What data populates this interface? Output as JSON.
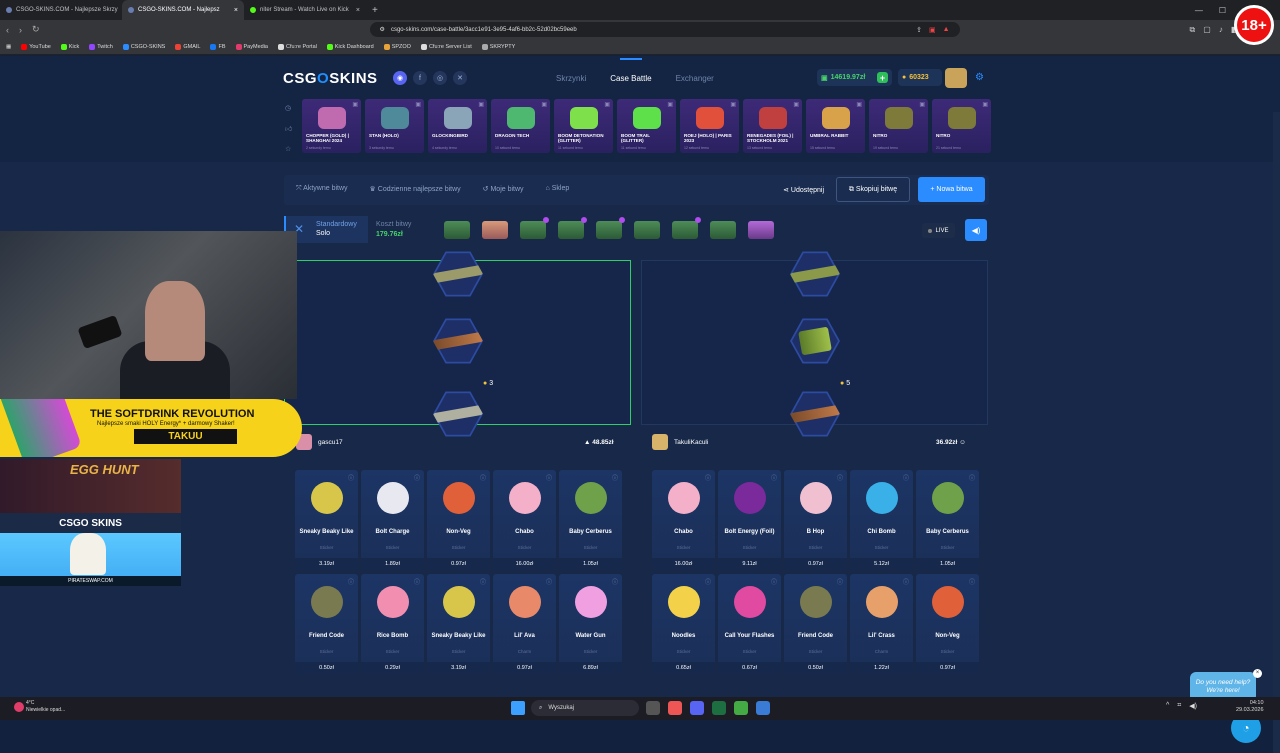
{
  "browser": {
    "tabs": [
      {
        "title": "CSGO-SKINS.COM - Najlepsze Skrzy"
      },
      {
        "title": "CSGO-SKINS.COM - Najlepsz"
      },
      {
        "title": "niter Stream - Watch Live on Kick"
      }
    ],
    "url": "csgo-skins.com/case-battle/3acc1e91-3e95-4af6-bb2c-52d02bc59eeb",
    "bookmarks": [
      "YouTube",
      "Kick",
      "Twitch",
      "CSGO-SKINS",
      "GMAIL",
      "FB",
      "PayMedia",
      "Cfu:re Portal",
      "Kick Dashboard",
      "SPZOO",
      "Cfu:re Server List",
      "SKRYPTY"
    ],
    "age_badge": "18+"
  },
  "site": {
    "logo_left": "CSG",
    "logo_o": "O",
    "logo_right": "SKINS",
    "nav": [
      "Skrzynki",
      "Case Battle",
      "Exchanger"
    ],
    "balance": "14619.97zł",
    "coins": "60323"
  },
  "feed": [
    {
      "name": "CHOPPER (GOLD) | SHANGHAI 2024",
      "time": "2 sekundy temu",
      "color": "#c06ab0"
    },
    {
      "name": "STAN (HOLO)",
      "time": "3 sekundy temu",
      "color": "#4f8a9a"
    },
    {
      "name": "GLOCKINGBIRD",
      "time": "4 sekundy temu",
      "color": "#8aa4b8"
    },
    {
      "name": "DRAGON TECH",
      "time": "10 sekund temu",
      "color": "#4fb870"
    },
    {
      "name": "BOOM DETONATION (GLITTER)",
      "time": "11 sekund temu",
      "color": "#7ee04a"
    },
    {
      "name": "BOOM TRAIL (GLITTER)",
      "time": "11 sekund temu",
      "color": "#5de04a"
    },
    {
      "name": "ROEJ (HOLO) | PARIS 2023",
      "time": "12 sekund temu",
      "color": "#e0503a"
    },
    {
      "name": "RENEGADES (FOIL) | STOCKHOLM 2021",
      "time": "13 sekund temu",
      "color": "#c04040"
    },
    {
      "name": "UMBRAL RABBIT",
      "time": "15 sekund temu",
      "color": "#d8a24a"
    },
    {
      "name": "NITRO",
      "time": "19 sekund temu",
      "color": "#7d7a3a"
    },
    {
      "name": "NITRO",
      "time": "21 sekund temu",
      "color": "#7d7a3a"
    }
  ],
  "subnav": {
    "items": [
      "Aktywne bitwy",
      "Codzienne najlepsze bitwy",
      "Moje bitwy",
      "Sklep"
    ],
    "share": "Udostępnij",
    "copy": "Skopiuj bitwę",
    "new": "Nowa bitwa"
  },
  "battle": {
    "mode": "Standardowy",
    "type": "Solo",
    "cost_label": "Koszt bitwy",
    "cost": "179.76zł",
    "live": "LIVE"
  },
  "arena": {
    "left_coins": "3",
    "right_coins": "5"
  },
  "players": [
    {
      "name": "gascu17",
      "value": "48.85zł",
      "items": [
        {
          "n": "Sneaky Beaky Like",
          "t": "Sticker",
          "p": "3.19zł",
          "c": "#d7c64a"
        },
        {
          "n": "Bolt Charge",
          "t": "Sticker",
          "p": "1.89zł",
          "c": "#e8e8f0"
        },
        {
          "n": "Non-Veg",
          "t": "Sticker",
          "p": "0.97zł",
          "c": "#e0603a"
        },
        {
          "n": "Chabo",
          "t": "Sticker",
          "p": "16.00zł",
          "c": "#f3b0c8"
        },
        {
          "n": "Baby Cerberus",
          "t": "Sticker",
          "p": "1.05zł",
          "c": "#6fa04a"
        },
        {
          "n": "Friend Code",
          "t": "Sticker",
          "p": "0.50zł",
          "c": "#7a7a50"
        },
        {
          "n": "Rice Bomb",
          "t": "Sticker",
          "p": "0.29zł",
          "c": "#f28fb0"
        },
        {
          "n": "Sneaky Beaky Like",
          "t": "Sticker",
          "p": "3.19zł",
          "c": "#d7c64a"
        },
        {
          "n": "Lil' Ava",
          "t": "Charm",
          "p": "0.97zł",
          "c": "#e88a6a"
        },
        {
          "n": "Water Gun",
          "t": "Sticker",
          "p": "6.89zł",
          "c": "#f0a0e0"
        }
      ]
    },
    {
      "name": "TakuliKaculi",
      "value": "36.92zł",
      "items": [
        {
          "n": "Chabo",
          "t": "Sticker",
          "p": "16.00zł",
          "c": "#f3b0c8"
        },
        {
          "n": "Bolt Energy (Foil)",
          "t": "Sticker",
          "p": "9.11zł",
          "c": "#7a2a9a"
        },
        {
          "n": "B Hop",
          "t": "Sticker",
          "p": "0.97zł",
          "c": "#f0c0d0"
        },
        {
          "n": "Chi Bomb",
          "t": "Sticker",
          "p": "5.12zł",
          "c": "#3ab0e8"
        },
        {
          "n": "Baby Cerberus",
          "t": "Sticker",
          "p": "1.05zł",
          "c": "#6fa04a"
        },
        {
          "n": "Noodles",
          "t": "Sticker",
          "p": "0.65zł",
          "c": "#f3d24a"
        },
        {
          "n": "Call Your Flashes",
          "t": "Sticker",
          "p": "0.67zł",
          "c": "#e04aa0"
        },
        {
          "n": "Friend Code",
          "t": "Sticker",
          "p": "0.50zł",
          "c": "#7a7a50"
        },
        {
          "n": "Lil' Crass",
          "t": "Charm",
          "p": "1.22zł",
          "c": "#e8a06a"
        },
        {
          "n": "Non-Veg",
          "t": "Sticker",
          "p": "0.97zł",
          "c": "#e0603a"
        }
      ]
    }
  ],
  "overlay": {
    "ad_title": "THE SOFTDRINK REVOLUTION",
    "ad_sub": "Najlepsze smaki HOLY Energy* + darmowy Shaker!",
    "ad_code": "TAKUU",
    "egg": "EGG HUNT",
    "csgo_label": "CSGO SKINS",
    "pirate": "PIRATESWAP.COM"
  },
  "help": {
    "text": "Do you need help? We're here!"
  },
  "taskbar": {
    "temp": "4°C",
    "weather": "Niewielkie opad...",
    "search": "Wyszukaj",
    "time": "04:10",
    "date": "29.03.2026"
  }
}
